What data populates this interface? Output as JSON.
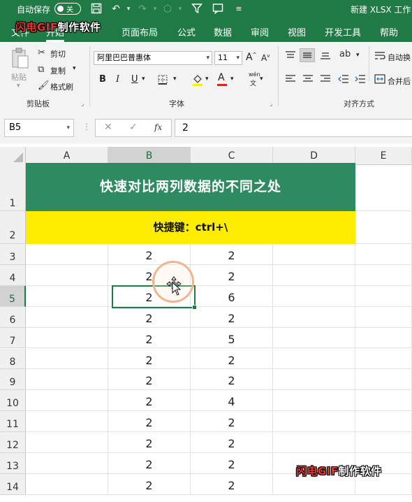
{
  "titlebar": {
    "autosave_label": "自动保存",
    "autosave_state": "关",
    "doc_title": "新建 XLSX 工作"
  },
  "watermark": {
    "red_part": "闪电GIF",
    "white_part": "制作软件"
  },
  "tabs": [
    "文件",
    "开始",
    "页面布局",
    "公式",
    "数据",
    "审阅",
    "视图",
    "开发工具",
    "帮助"
  ],
  "ribbon": {
    "clipboard": {
      "paste": "粘贴",
      "cut": "剪切",
      "copy": "复制",
      "format_painter": "格式刷",
      "group": "剪贴板"
    },
    "font": {
      "font_name": "阿里巴巴普惠体",
      "font_size": "11",
      "grow": "A",
      "shrink": "A",
      "bold": "B",
      "italic": "I",
      "underline": "U",
      "font_color": "A",
      "phonetic": "wén",
      "group": "字体"
    },
    "alignment": {
      "wrap_text": "自动换",
      "merge": "合并后",
      "group": "对齐方式"
    }
  },
  "formula_bar": {
    "name_box": "B5",
    "cancel_icon": "✕",
    "enter_icon": "✓",
    "fx": "fx",
    "formula": "2"
  },
  "sheet": {
    "columns": [
      "A",
      "B",
      "C",
      "D",
      "E"
    ],
    "rows": [
      "1",
      "2",
      "3",
      "4",
      "5",
      "6",
      "7",
      "8",
      "9",
      "10",
      "11",
      "12",
      "13",
      "14"
    ],
    "title": "快速对比两列数据的不同之处",
    "subtitle": "快捷键：ctrl+\\",
    "colB": [
      "2",
      "2",
      "2",
      "2",
      "2",
      "2",
      "2",
      "2",
      "2",
      "2",
      "2",
      "2"
    ],
    "colC": [
      "2",
      "2",
      "6",
      "2",
      "5",
      "2",
      "2",
      "4",
      "2",
      "2",
      "2",
      "2"
    ]
  },
  "colors": {
    "accent": "#1f7a46",
    "title_fill": "#2e8b61",
    "subtitle_fill": "#ffed00"
  }
}
